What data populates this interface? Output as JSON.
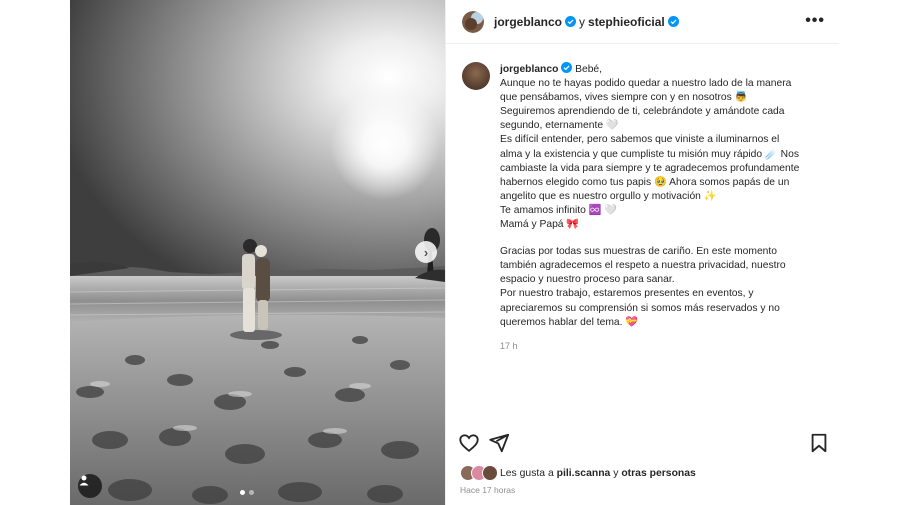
{
  "header": {
    "author": "jorgeblanco",
    "connector": "y",
    "coauthor": "stephieoficial",
    "more_label": "•••"
  },
  "caption": {
    "username": "jorgeblanco",
    "lines": [
      "Bebé,",
      "Aunque no te hayas podido quedar a nuestro lado de la manera que pensábamos, vives siempre con y en nosotros 👼 Seguiremos aprendiendo de ti, celebrándote y amándote cada segundo, eternamente 🤍",
      "Es difícil entender, pero sabemos que viniste a iluminarnos el alma y la existencia y que cumpliste tu misión muy rápido ☄️ Nos cambiaste la vida para siempre y te agradecemos profundamente habernos elegido como tus papis 🥹 Ahora somos papás de un angelito que es nuestro orgullo y motivación ✨",
      "Te amamos infinito ♾️ 🤍",
      "Mamá y Papá 🎀"
    ],
    "paragraph2": "Gracias por todas sus muestras de cariño. En este momento también agradecemos el respeto a nuestra privacidad, nuestro espacio y nuestro proceso para sanar.",
    "paragraph3": "Por nuestro trabajo, estaremos presentes en eventos, y apreciaremos su comprensión si somos más reservados y no queremos hablar del tema. 💝",
    "time": "17 h"
  },
  "likes": {
    "prefix": "Les gusta a",
    "user": "pili.scanna",
    "connector": "y",
    "others": "otras personas"
  },
  "posted_ago": "Hace 17 horas",
  "icons": {
    "like": "heart-icon",
    "share": "send-icon",
    "save": "bookmark-icon",
    "next": "chevron-right-icon",
    "tag": "user-tag-icon",
    "verified": "verified-badge-icon"
  },
  "colors": {
    "verified": "#0095f6",
    "text": "#262626",
    "muted": "#8e8e8e"
  }
}
